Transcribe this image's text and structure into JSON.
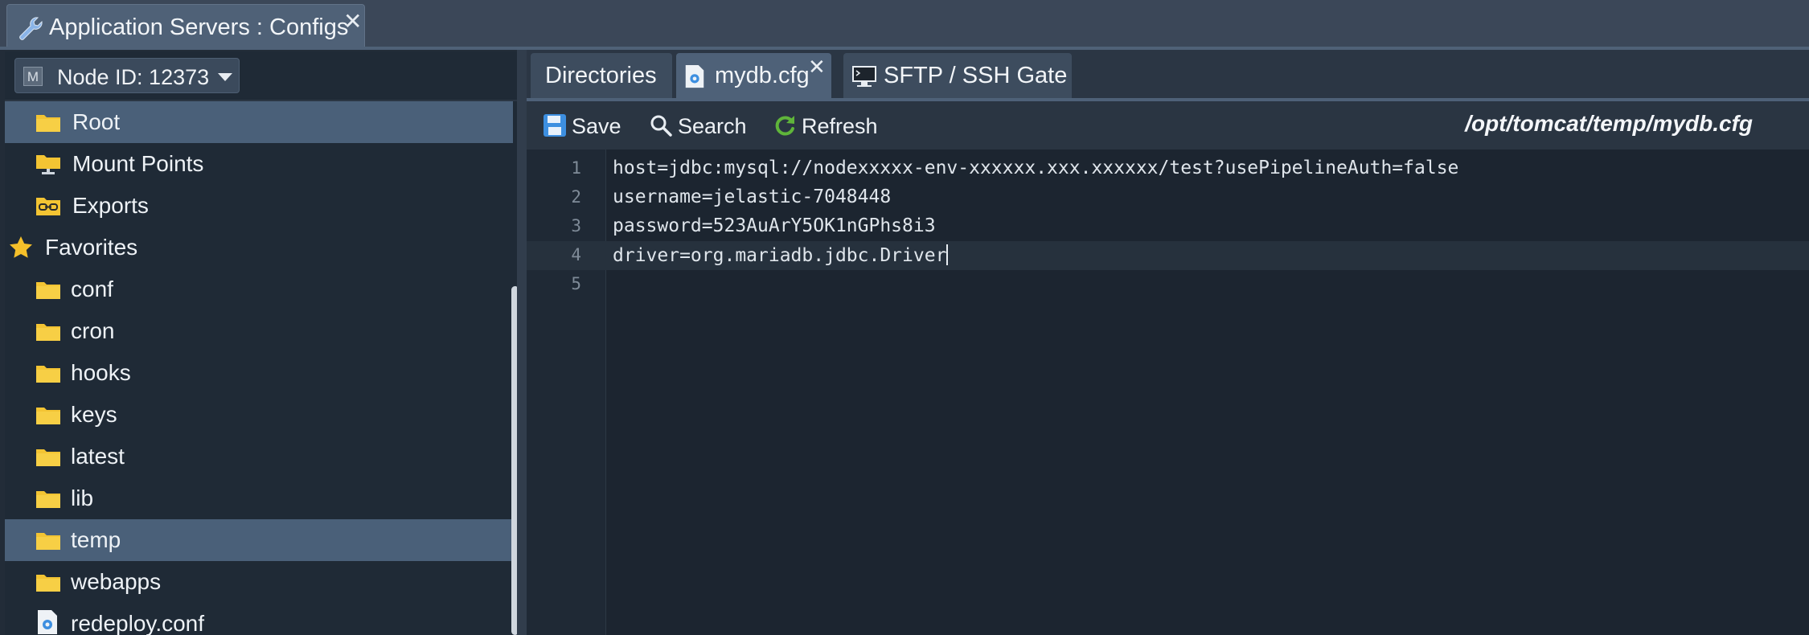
{
  "window": {
    "title": "Application Servers : Configs",
    "close_symbol": "✕"
  },
  "node": {
    "label": "Node ID: 12373",
    "icon_letter": "M"
  },
  "tree": {
    "items": [
      {
        "label": "Root",
        "icon": "folder-icon",
        "selected": true
      },
      {
        "label": "Mount Points",
        "icon": "mount-points-icon",
        "selected": false
      },
      {
        "label": "Exports",
        "icon": "exports-icon",
        "selected": false
      },
      {
        "label": "Favorites",
        "icon": "star-icon",
        "selected": false
      },
      {
        "label": "conf",
        "icon": "folder-icon",
        "selected": false
      },
      {
        "label": "cron",
        "icon": "folder-icon",
        "selected": false
      },
      {
        "label": "hooks",
        "icon": "folder-icon",
        "selected": false
      },
      {
        "label": "keys",
        "icon": "folder-icon",
        "selected": false
      },
      {
        "label": "latest",
        "icon": "folder-icon",
        "selected": false
      },
      {
        "label": "lib",
        "icon": "folder-icon",
        "selected": false
      },
      {
        "label": "temp",
        "icon": "folder-icon",
        "selected": true
      },
      {
        "label": "webapps",
        "icon": "folder-icon",
        "selected": false
      },
      {
        "label": "redeploy.conf",
        "icon": "config-file-icon",
        "selected": false
      }
    ]
  },
  "tabs": [
    {
      "label": "Directories",
      "active": false
    },
    {
      "label": "mydb.cfg",
      "active": true,
      "close_symbol": "✕"
    },
    {
      "label": "SFTP / SSH Gate",
      "active": false
    }
  ],
  "toolbar": {
    "save_label": "Save",
    "search_label": "Search",
    "refresh_label": "Refresh"
  },
  "file_path": "/opt/tomcat/temp/mydb.cfg",
  "editor": {
    "lines": [
      {
        "num": "1",
        "text": "host=jdbc:mysql://nodexxxxx-env-xxxxxx.xxx.xxxxxx/test?usePipelineAuth=false"
      },
      {
        "num": "2",
        "text": "username=jelastic-7048448"
      },
      {
        "num": "3",
        "text": "password=523AuArY5OK1nGPhs8i3"
      },
      {
        "num": "4",
        "text": "driver=org.mariadb.jdbc.Driver"
      },
      {
        "num": "5",
        "text": ""
      }
    ],
    "current_line": 4
  },
  "colors": {
    "folder": "#f3c433",
    "star": "#f5c02a",
    "save": "#3d8fe0",
    "refresh": "#5fb53a"
  }
}
